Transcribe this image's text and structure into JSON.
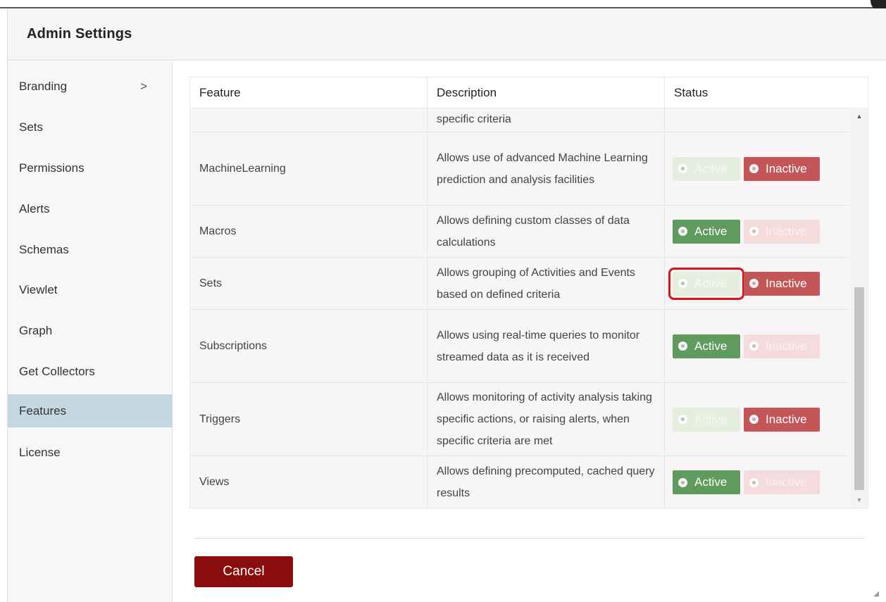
{
  "dialog": {
    "title": "Admin Settings"
  },
  "sidebar": {
    "items": [
      {
        "label": "Branding",
        "chevron": ">",
        "active": false
      },
      {
        "label": "Sets",
        "active": false
      },
      {
        "label": "Permissions",
        "active": false
      },
      {
        "label": "Alerts",
        "active": false
      },
      {
        "label": "Schemas",
        "active": false
      },
      {
        "label": "Viewlet",
        "active": false
      },
      {
        "label": "Graph",
        "active": false
      },
      {
        "label": "Get Collectors",
        "active": false
      },
      {
        "label": "Features",
        "active": true
      },
      {
        "label": "License",
        "active": false
      }
    ]
  },
  "table": {
    "headers": {
      "feature": "Feature",
      "description": "Description",
      "status": "Status"
    },
    "partial_row": {
      "description": "specific criteria"
    },
    "rows": [
      {
        "feature": "MachineLearning",
        "description": "Allows use of advanced Machine Learning prediction and analysis facilities",
        "status": "Inactive"
      },
      {
        "feature": "Macros",
        "description": "Allows defining custom classes of data calculations",
        "status": "Active"
      },
      {
        "feature": "Sets",
        "description": "Allows grouping of Activities and Events based on defined criteria",
        "status": "Inactive"
      },
      {
        "feature": "Subscriptions",
        "description": "Allows using real-time queries to monitor streamed data as it is received",
        "status": "Active"
      },
      {
        "feature": "Triggers",
        "description": "Allows monitoring of activity analysis taking specific actions, or raising alerts, when specific criteria are met",
        "status": "Inactive"
      },
      {
        "feature": "Views",
        "description": "Allows defining precomputed, cached query results",
        "status": "Active"
      }
    ],
    "labels": {
      "active": "Active",
      "inactive": "Inactive"
    }
  },
  "scroll": {
    "up": "▲",
    "down": "▼"
  },
  "footer": {
    "cancel_label": "Cancel"
  },
  "colors": {
    "active_green": "#5e9b5c",
    "inactive_red": "#c35758",
    "cancel_red": "#8b0c0c",
    "selected_nav": "#c4d8e1"
  }
}
